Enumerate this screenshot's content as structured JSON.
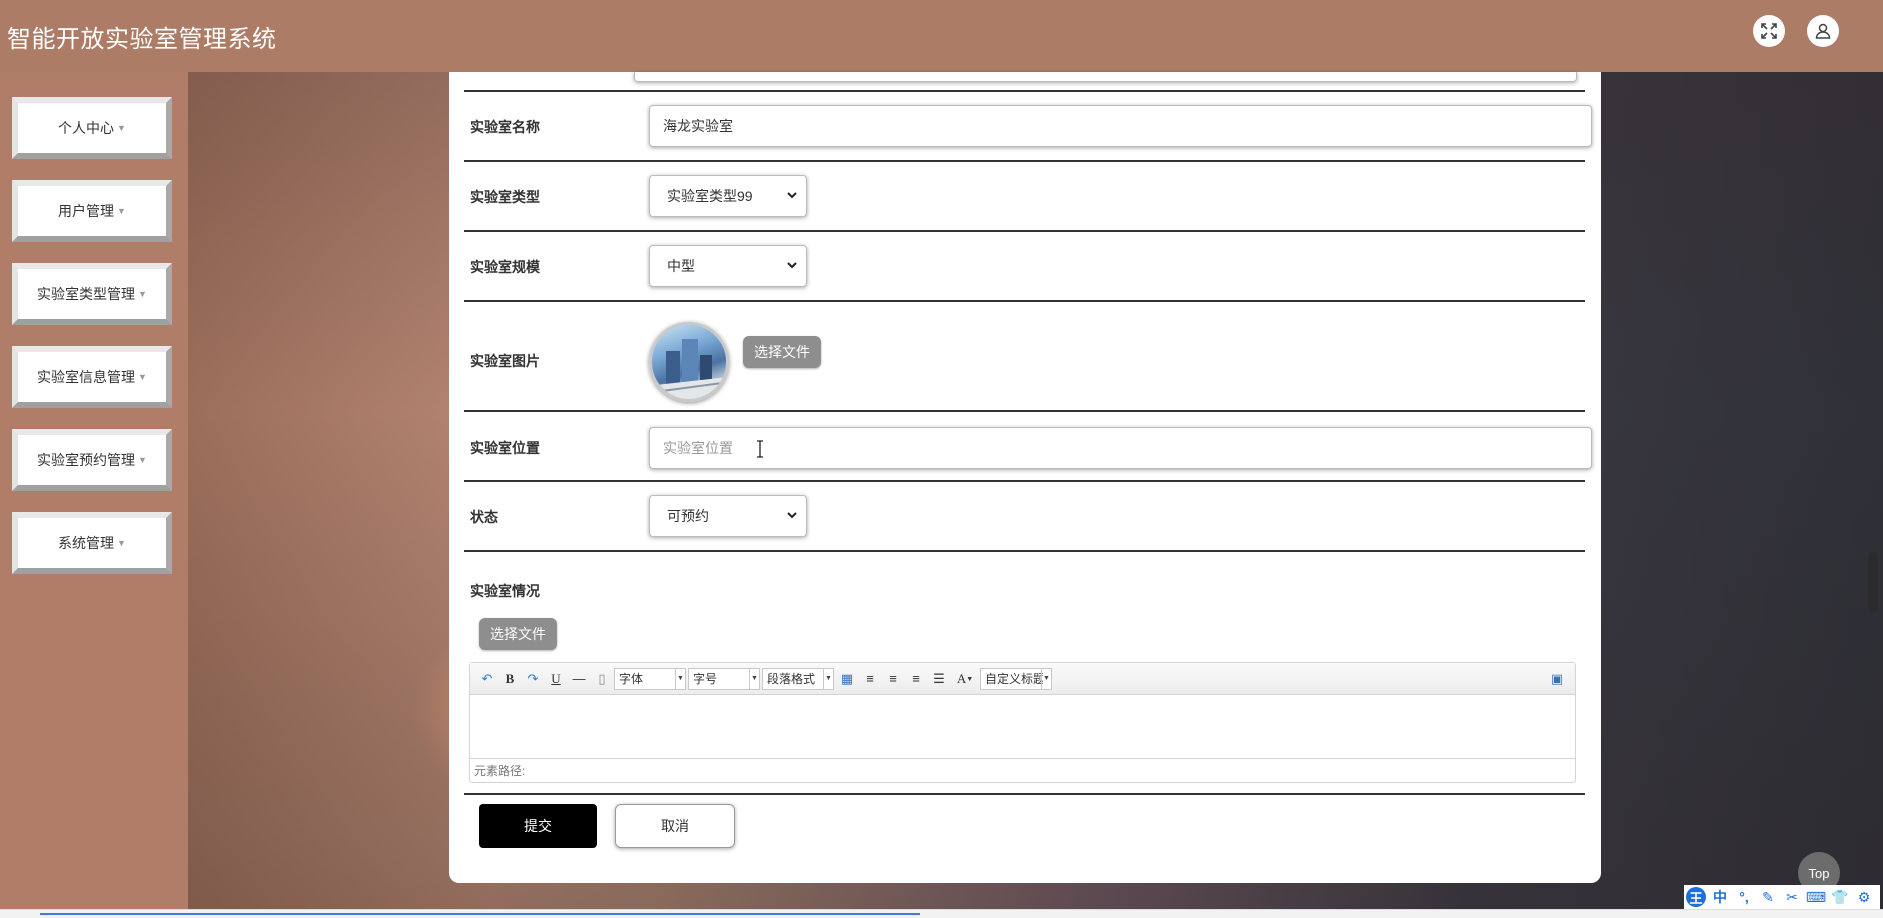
{
  "app": {
    "title": "智能开放实验室管理系统"
  },
  "header_icons": [
    "fullscreen-icon",
    "user-icon"
  ],
  "sidebar": {
    "items": [
      {
        "label": "个人中心"
      },
      {
        "label": "用户管理"
      },
      {
        "label": "实验室类型管理"
      },
      {
        "label": "实验室信息管理"
      },
      {
        "label": "实验室预约管理"
      },
      {
        "label": "系统管理"
      }
    ]
  },
  "form": {
    "name": {
      "label": "实验室名称",
      "value": "海龙实验室"
    },
    "type": {
      "label": "实验室类型",
      "value": "实验室类型99"
    },
    "scale": {
      "label": "实验室规模",
      "value": "中型"
    },
    "image": {
      "label": "实验室图片",
      "choose_file": "选择文件"
    },
    "location": {
      "label": "实验室位置",
      "placeholder": "实验室位置",
      "value": ""
    },
    "status": {
      "label": "状态",
      "value": "可预约"
    },
    "details": {
      "label": "实验室情况",
      "choose_file": "选择文件"
    }
  },
  "editor": {
    "font_combo": "字体",
    "size_combo": "字号",
    "paragraph_combo": "段落格式",
    "custom_title_combo": "自定义标题",
    "bold": "B",
    "underline": "U",
    "font_color": "A",
    "path_label": "元素路径:"
  },
  "actions": {
    "submit": "提交",
    "cancel": "取消"
  },
  "top_button": "Top",
  "ime": {
    "mode": "中"
  },
  "colors": {
    "header": "#ad7c66",
    "sidebar": "#b07d68",
    "submit_bg": "#000000",
    "grey_button": "#8e8e8e"
  }
}
